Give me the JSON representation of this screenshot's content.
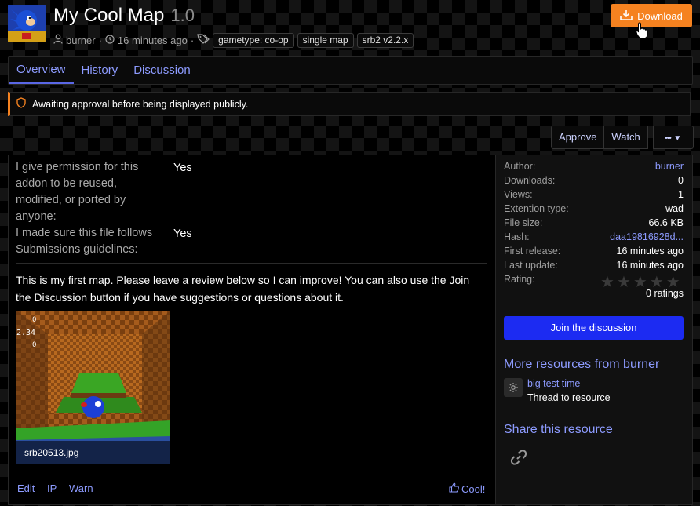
{
  "header": {
    "title": "My Cool Map",
    "version": "1.0",
    "author": "burner",
    "separator": "·",
    "time": "16 minutes ago",
    "tags": [
      "gametype: co-op",
      "single map",
      "srb2 v2.2.x"
    ],
    "download_label": "Download"
  },
  "tabs": [
    {
      "label": "Overview",
      "active": true
    },
    {
      "label": "History",
      "active": false
    },
    {
      "label": "Discussion",
      "active": false
    }
  ],
  "notice": {
    "text": "Awaiting approval before being displayed publicly."
  },
  "actions": {
    "approve": "Approve",
    "watch": "Watch",
    "more": "•••"
  },
  "fields": [
    {
      "label": "I give permission for this addon to be reused, modified, or ported by anyone:",
      "value": "Yes"
    },
    {
      "label": "I made sure this file follows Submissions guidelines:",
      "value": "Yes"
    }
  ],
  "description": "This is my first map. Please leave a review below so I can improve! You can also use the Join the Discussion button if you have suggestions or questions about it.",
  "attachment": {
    "filename": "srb20513.jpg",
    "hud": [
      "0",
      "2.34",
      "0"
    ]
  },
  "footer": {
    "edit": "Edit",
    "ip": "IP",
    "warn": "Warn",
    "reaction": "Cool!"
  },
  "sidebar": {
    "info": [
      {
        "label": "Author:",
        "value": "burner",
        "link": true
      },
      {
        "label": "Downloads:",
        "value": "0",
        "link": false
      },
      {
        "label": "Views:",
        "value": "1",
        "link": false
      },
      {
        "label": "Extention type:",
        "value": "wad",
        "link": false
      },
      {
        "label": "File size:",
        "value": "66.6 KB",
        "link": false
      },
      {
        "label": "Hash:",
        "value": "daa19816928d...",
        "link": true
      },
      {
        "label": "First release:",
        "value": "16 minutes ago",
        "link": false
      },
      {
        "label": "Last update:",
        "value": "16 minutes ago",
        "link": false
      },
      {
        "label": "Rating:",
        "value": "",
        "link": false
      }
    ],
    "rating_stars": 0,
    "rating_max": 5,
    "ratings_count": "0 ratings",
    "join_label": "Join the discussion",
    "more_title": "More resources from burner",
    "more_item_title": "big test time",
    "more_item_sub": "Thread to resource",
    "share_title": "Share this resource"
  },
  "colors": {
    "accent_orange": "#f58220",
    "link_blue": "#8d9bff",
    "primary_button": "#1c2bf2"
  }
}
